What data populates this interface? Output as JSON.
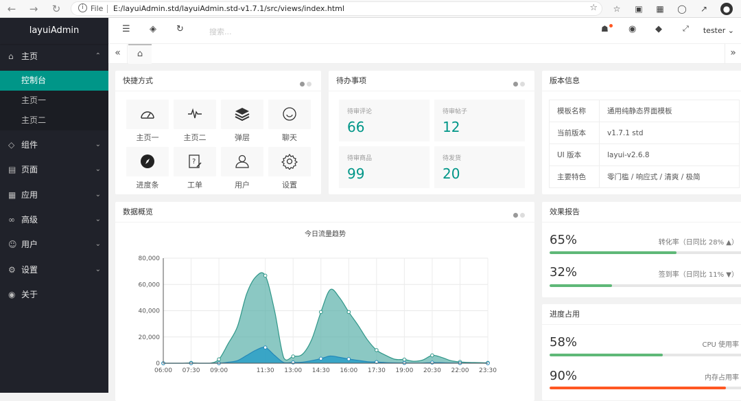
{
  "browser": {
    "file_label": "File",
    "url": "E:/layuiAdmin.std/layuiAdmin.std-v1.7.1/src/views/index.html"
  },
  "sidebar": {
    "logo": "layuiAdmin",
    "menu": [
      {
        "label": "主页",
        "icon": "home-icon"
      },
      {
        "label": "组件",
        "icon": "cube-icon"
      },
      {
        "label": "页面",
        "icon": "page-icon"
      },
      {
        "label": "应用",
        "icon": "app-icon"
      },
      {
        "label": "高级",
        "icon": "senior-icon"
      },
      {
        "label": "用户",
        "icon": "user-icon"
      },
      {
        "label": "设置",
        "icon": "gear-icon"
      },
      {
        "label": "关于",
        "icon": "about-icon"
      }
    ],
    "submenu": [
      "控制台",
      "主页一",
      "主页二"
    ]
  },
  "topbar": {
    "search_placeholder": "搜索...",
    "username": "tester"
  },
  "shortcuts": {
    "title": "快捷方式",
    "items": [
      {
        "label": "主页一",
        "icon": "gauge-icon"
      },
      {
        "label": "主页二",
        "icon": "pulse-icon"
      },
      {
        "label": "弹层",
        "icon": "layers-icon"
      },
      {
        "label": "聊天",
        "icon": "chat-icon"
      },
      {
        "label": "进度条",
        "icon": "compass-icon"
      },
      {
        "label": "工单",
        "icon": "form-icon"
      },
      {
        "label": "用户",
        "icon": "user-icon"
      },
      {
        "label": "设置",
        "icon": "gear-icon"
      }
    ]
  },
  "todo": {
    "title": "待办事项",
    "items": [
      {
        "label": "待审评论",
        "value": "66"
      },
      {
        "label": "待审帖子",
        "value": "12"
      },
      {
        "label": "待审商品",
        "value": "99"
      },
      {
        "label": "待发货",
        "value": "20"
      }
    ]
  },
  "version": {
    "title": "版本信息",
    "rows": [
      {
        "key": "模板名称",
        "value": "通用纯静态界面模板"
      },
      {
        "key": "当前版本",
        "value": "v1.7.1 std"
      },
      {
        "key": "UI 版本",
        "value": "layui-v2.6.8"
      },
      {
        "key": "主要特色",
        "value": "零门槛 / 响应式 / 清爽 / 极简"
      }
    ]
  },
  "overview": {
    "title": "数据概览"
  },
  "effect": {
    "title": "效果报告",
    "items": [
      {
        "value": "65%",
        "label": "转化率（日同比 28% ▲）",
        "percent": 65,
        "color": "#5fb878"
      },
      {
        "value": "32%",
        "label": "签到率（日同比 11% ▼）",
        "percent": 32,
        "color": "#5fb878"
      }
    ]
  },
  "progress": {
    "title": "进度占用",
    "items": [
      {
        "value": "58%",
        "label": "CPU 使用率",
        "percent": 58,
        "color": "#5fb878"
      },
      {
        "value": "90%",
        "label": "内存占用率",
        "percent": 90,
        "color": "#ff5722"
      }
    ]
  },
  "chart_data": {
    "type": "area",
    "title": "今日流量趋势",
    "x": [
      "06:00",
      "06:30",
      "07:00",
      "07:30",
      "08:00",
      "08:30",
      "09:00",
      "09:30",
      "10:00",
      "10:30",
      "11:00",
      "11:30",
      "12:00",
      "12:30",
      "13:00",
      "13:30",
      "14:00",
      "14:30",
      "15:00",
      "15:30",
      "16:00",
      "16:30",
      "17:00",
      "17:30",
      "18:00",
      "18:30",
      "19:00",
      "19:30",
      "20:00",
      "20:30",
      "21:00",
      "21:30",
      "22:00",
      "22:30",
      "23:00",
      "23:30"
    ],
    "x_tick_labels": [
      "06:00",
      "07:30",
      "09:00",
      "11:30",
      "13:00",
      "14:30",
      "16:00",
      "17:30",
      "19:00",
      "20:30",
      "22:00",
      "23:30"
    ],
    "y_tick_labels": [
      "0",
      "20,000",
      "40,000",
      "60,000",
      "80,000"
    ],
    "ylim": [
      0,
      80000
    ],
    "series": [
      {
        "values": [
          0,
          0,
          0,
          290,
          0,
          0,
          3000,
          15000,
          28000,
          53000,
          66000,
          66690,
          40000,
          4000,
          5200,
          6800,
          18000,
          39000,
          56000,
          50000,
          39000,
          29000,
          18000,
          10000,
          6000,
          3000,
          2800,
          1500,
          2500,
          6000,
          4500,
          2000,
          1000,
          600,
          500,
          300
        ],
        "color": "#5ab1a9"
      },
      {
        "values": [
          0,
          0,
          0,
          0,
          0,
          0,
          0,
          800,
          2000,
          6000,
          10000,
          12000,
          6000,
          500,
          600,
          800,
          2000,
          3500,
          5500,
          4500,
          3200,
          2200,
          1200,
          900,
          500,
          300,
          200,
          100,
          150,
          500,
          400,
          200,
          100,
          50,
          30,
          0
        ],
        "color": "#2a9fc7"
      }
    ],
    "grid": true
  }
}
